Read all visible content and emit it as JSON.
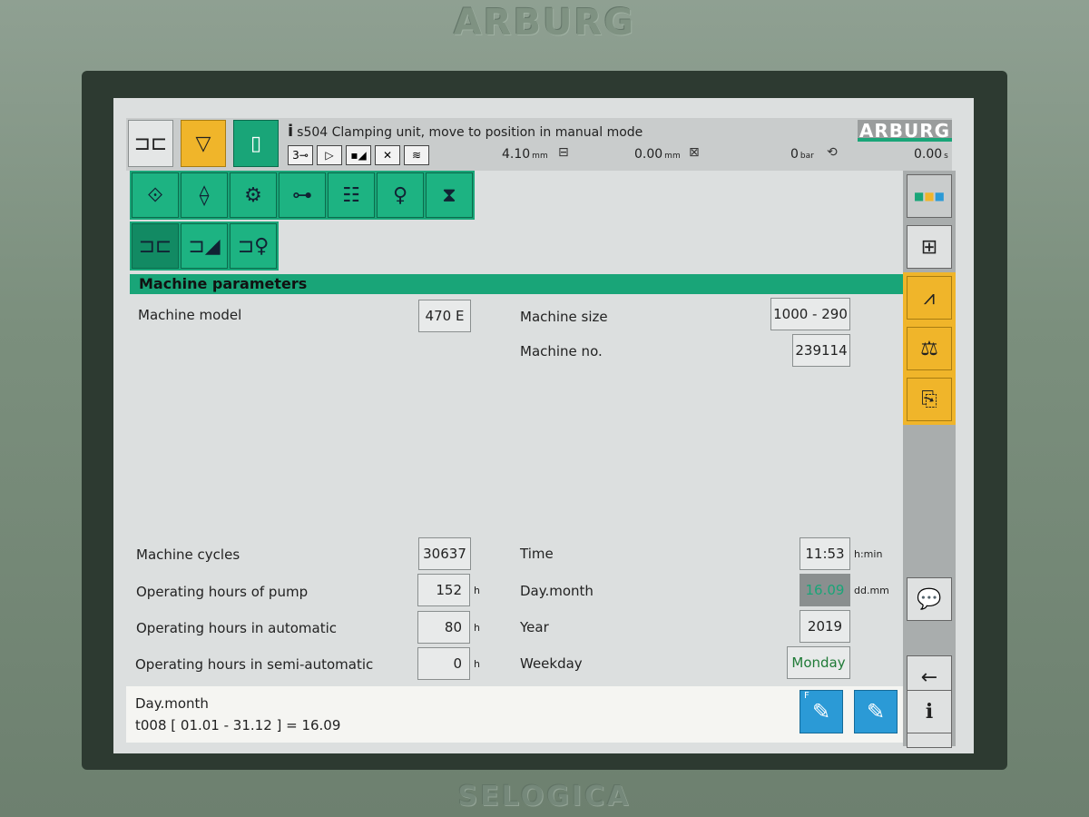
{
  "brand": {
    "bezel_logo": "ARBURG",
    "screen_logo": "ARBURG",
    "bottom_logo": "SELOGICA"
  },
  "header": {
    "message_icon": "i",
    "message": "s504 Clamping unit, move to position in manual mode",
    "position_value": "4.10",
    "position_unit": "mm",
    "travel_value": "0.00",
    "travel_unit": "mm",
    "pressure_value": "0",
    "pressure_unit": "bar",
    "time_value": "0.00",
    "time_unit": "s"
  },
  "section": {
    "title": "Machine parameters"
  },
  "params": {
    "machine_model_label": "Machine model",
    "machine_model_value": "470 E",
    "machine_size_label": "Machine size",
    "machine_size_value": "1000 - 290",
    "machine_no_label": "Machine no.",
    "machine_no_value": "239114",
    "machine_cycles_label": "Machine cycles",
    "machine_cycles_value": "30637",
    "pump_hours_label": "Operating hours of pump",
    "pump_hours_value": "152",
    "pump_hours_unit": "h",
    "auto_hours_label": "Operating hours in automatic",
    "auto_hours_value": "80",
    "auto_hours_unit": "h",
    "semi_hours_label": "Operating hours in semi-automatic",
    "semi_hours_value": "0",
    "semi_hours_unit": "h",
    "time_label": "Time",
    "time_value": "11:53",
    "time_unit": "h:min",
    "daymonth_label": "Day.month",
    "daymonth_value": "16.09",
    "daymonth_unit": "dd.mm",
    "year_label": "Year",
    "year_value": "2019",
    "weekday_label": "Weekday",
    "weekday_value": "Monday"
  },
  "info": {
    "line1": "Day.month",
    "line2": "t008 [ 01.01 - 31.12 ] = 16.09",
    "btn_f_label": "F"
  },
  "sidebar": {
    "info_label": "i"
  }
}
